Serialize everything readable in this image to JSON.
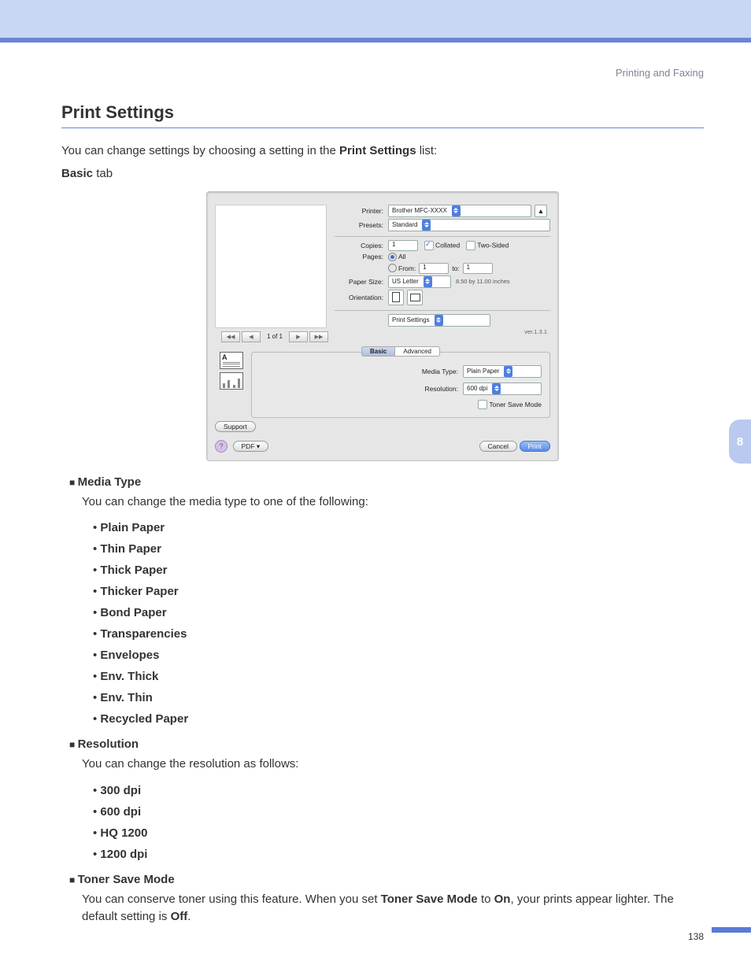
{
  "header": {
    "section": "Printing and Faxing"
  },
  "title": "Print Settings",
  "intro": {
    "pre": "You can change settings by choosing a setting in the ",
    "bold": "Print Settings",
    "post": " list:"
  },
  "tabline": {
    "bold": "Basic",
    "rest": " tab"
  },
  "dialog": {
    "printer": {
      "label": "Printer:",
      "value": "Brother MFC-XXXX"
    },
    "presets": {
      "label": "Presets:",
      "value": "Standard"
    },
    "copies": {
      "label": "Copies:",
      "value": "1",
      "collated": "Collated",
      "twosided": "Two-Sided"
    },
    "pages": {
      "label": "Pages:",
      "all": "All",
      "fromlabel": "From:",
      "from": "1",
      "tolabel": "to:",
      "to": "1"
    },
    "papersize": {
      "label": "Paper Size:",
      "value": "US Letter",
      "dims": "8.50 by 11.00 inches"
    },
    "orientation_label": "Orientation:",
    "panel_select": "Print Settings",
    "version": "ver.1.3.1",
    "tabs": {
      "basic": "Basic",
      "advanced": "Advanced"
    },
    "mediatype": {
      "label": "Media Type:",
      "value": "Plain Paper"
    },
    "resolution": {
      "label": "Resolution:",
      "value": "600 dpi"
    },
    "tonersave": "Toner Save Mode",
    "support": "Support",
    "pager": {
      "page": "1 of 1"
    },
    "footer": {
      "help": "?",
      "pdf": "PDF ▾",
      "cancel": "Cancel",
      "print": "Print"
    }
  },
  "sections": {
    "media": {
      "heading": "Media Type",
      "desc": "You can change the media type to one of the following:",
      "items": [
        "Plain Paper",
        "Thin Paper",
        "Thick Paper",
        "Thicker Paper",
        "Bond Paper",
        "Transparencies",
        "Envelopes",
        "Env. Thick",
        "Env. Thin",
        "Recycled Paper"
      ]
    },
    "resolution": {
      "heading": "Resolution",
      "desc": "You can change the resolution as follows:",
      "items": [
        "300 dpi",
        "600 dpi",
        "HQ 1200",
        "1200 dpi"
      ]
    },
    "toner": {
      "heading": "Toner Save Mode",
      "desc_pre": "You can conserve toner using this feature. When you set ",
      "b1": "Toner Save Mode",
      "mid1": " to ",
      "b2": "On",
      "mid2": ", your prints appear lighter. The default setting is ",
      "b3": "Off",
      "post": "."
    }
  },
  "chapter_tab": "8",
  "page_number": "138"
}
